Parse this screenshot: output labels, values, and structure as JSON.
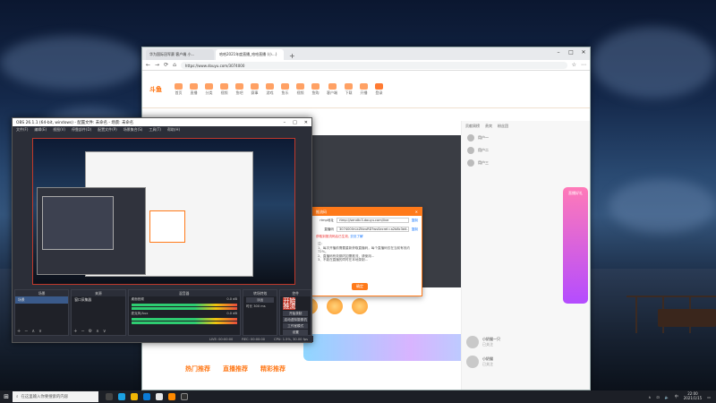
{
  "browser": {
    "tabs": [
      "华为国际冠军赛 客户端 小...",
      "哈哈2021年度直播_哈哈直播 (小...)"
    ],
    "url": "https://www.douyu.com/3074000",
    "site_logo": "斗鱼",
    "nav": [
      "首页",
      "直播",
      "分类",
      "视频",
      "鱼吧",
      "赛事",
      "游戏",
      "鱼乐",
      "视频",
      "鱼购",
      "客户端",
      "下载",
      "开播",
      "登录"
    ],
    "live_badge": "直播中",
    "follow": "关注",
    "tabs_bottom": [
      "热门推荐",
      "直播推荐",
      "精彩推荐"
    ],
    "right_tabs": [
      "贡献周榜",
      "贵宾",
      "粉丝团"
    ],
    "right_users": [
      "用户一",
      "用户二",
      "用户三"
    ],
    "right_list": [
      {
        "name": "小奶猫一只",
        "sub": "已关注"
      },
      {
        "name": "小奶猫",
        "sub": "已关注"
      }
    ],
    "side_promo": "直播好礼"
  },
  "dialog": {
    "title": "推流码",
    "rtmp_label": "rtmp地址",
    "rtmp_value": "rtmp://sendtc3.douyu.com/live",
    "key_label": "直播码",
    "key_value": "3074000rLkZNvuRD?wsSecret=a2b8c3d4...",
    "copy": "复制",
    "warn": "获取到推流码后已生效,",
    "warn_link": "去处了解",
    "notes": [
      "注:",
      "1、每次开播前需要重新获取直播码，每个直播码仅在当前有效约72%。",
      "2、直播码有效期内如需推流，请使用...",
      "3、不能在直播的同时在本地录制..."
    ],
    "ok": "确定"
  },
  "obs": {
    "title": "OBS 26.1.1 (64-bit, windows) - 配置文件: 未命名 - 场景: 未命名",
    "menu": [
      "文件(F)",
      "编辑(E)",
      "视图(V)",
      "停靠部件(D)",
      "配置文件(P)",
      "场景集合(S)",
      "工具(T)",
      "帮助(H)"
    ],
    "docks": {
      "scenes": {
        "header": "场景",
        "item": "场景"
      },
      "sources": {
        "header": "来源",
        "item": "窗口采集器"
      },
      "mixer": {
        "header": "混音器",
        "ch1": "桌面音频",
        "ch1_val": "0.0 dB",
        "ch2": "麦克风/Aux",
        "ch2_val": "0.0 dB"
      },
      "transitions": {
        "header": "转场特效",
        "type": "淡出",
        "duration_label": "时长",
        "duration": "300 ms"
      },
      "controls": {
        "header": "控件",
        "buttons": [
          "开始推流",
          "开始录制",
          "启动虚拟摄像机",
          "工作室模式",
          "设置",
          "退出"
        ]
      }
    },
    "status": [
      "LIVE: 00:00:00",
      "REC: 00:00:00",
      "CPU: 1.5%, 30.00 fps"
    ]
  },
  "taskbar": {
    "search_placeholder": "在这里输入你要搜索的内容",
    "time": "22:00",
    "date": "2021/1/15"
  }
}
